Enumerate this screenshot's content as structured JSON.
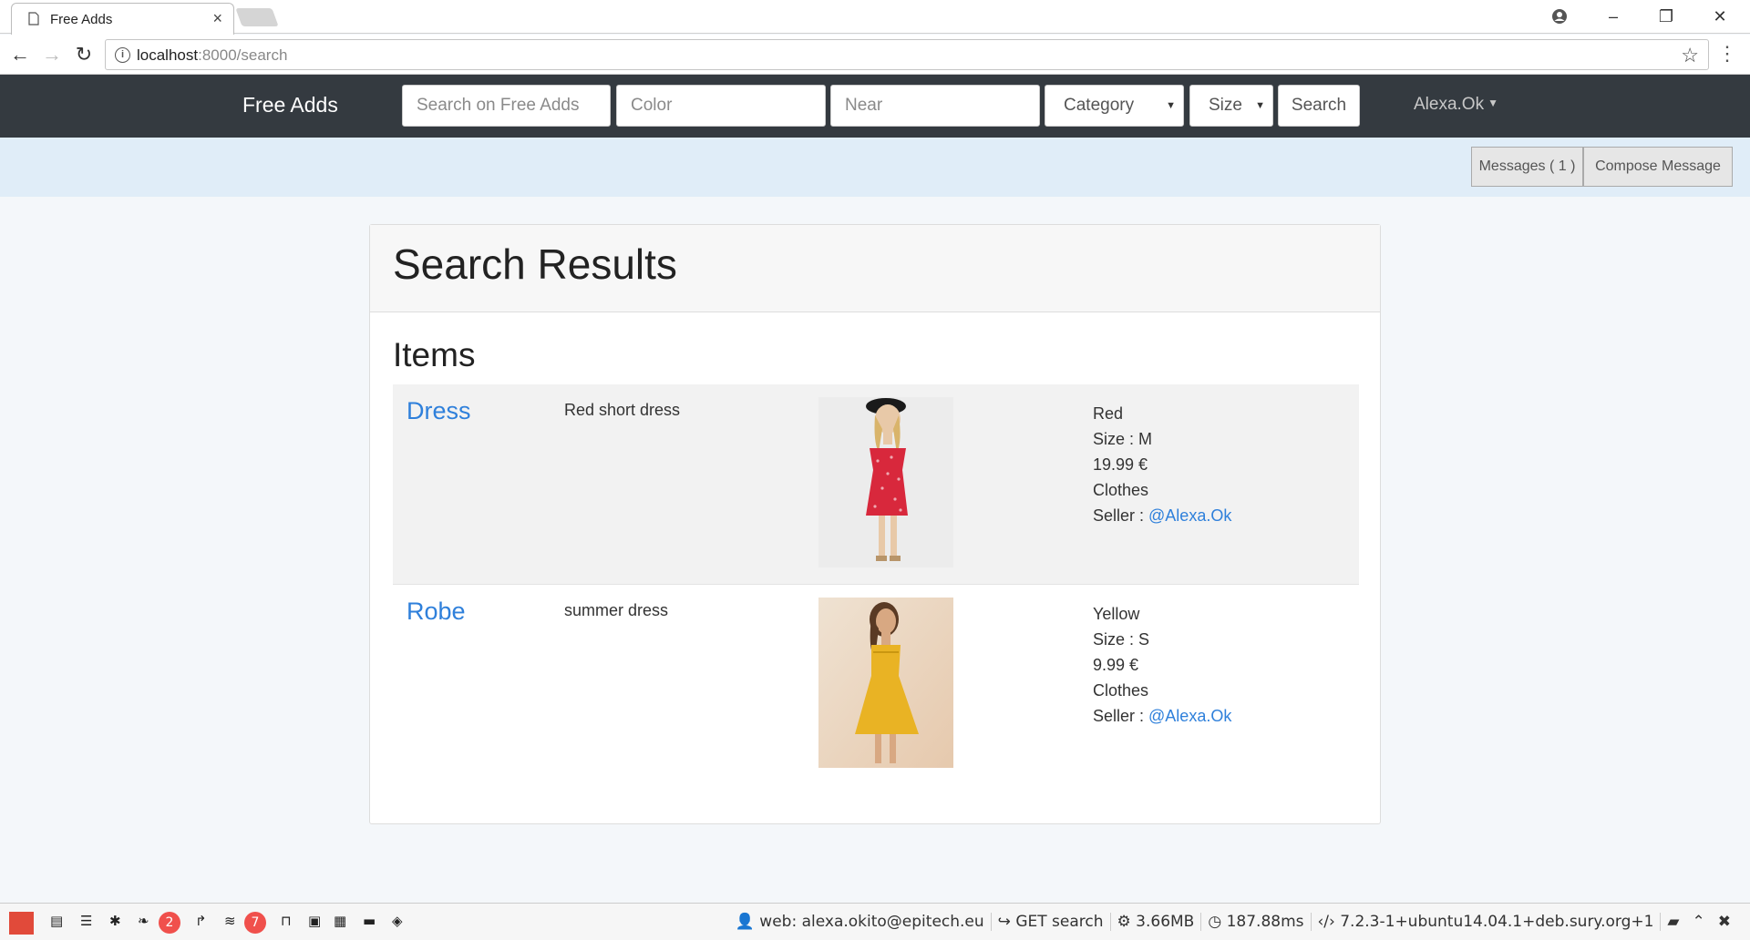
{
  "browser": {
    "tab_title": "Free Adds",
    "url_host": "localhost",
    "url_path": ":8000/search"
  },
  "navbar": {
    "brand": "Free Adds",
    "search_placeholder": "Search on Free Adds",
    "color_placeholder": "Color",
    "near_placeholder": "Near",
    "category_label": "Category",
    "size_label": "Size",
    "search_button": "Search",
    "user": "Alexa.Ok"
  },
  "subbar": {
    "messages_button": "Messages ( 1 )",
    "compose_button": "Compose Message"
  },
  "page": {
    "title": "Search Results",
    "items_heading": "Items"
  },
  "items": [
    {
      "name": "Dress",
      "description": "Red short dress",
      "color": "Red",
      "size": "Size : M",
      "price": "19.99 €",
      "category": "Clothes",
      "seller_label": "Seller : ",
      "seller": "@Alexa.Ok",
      "dress_color": "#d8283c"
    },
    {
      "name": "Robe",
      "description": "summer dress",
      "color": "Yellow",
      "size": "Size : S",
      "price": "9.99 €",
      "category": "Clothes",
      "seller_label": "Seller : ",
      "seller": "@Alexa.Ok",
      "dress_color": "#e9b324"
    }
  ],
  "debugbar": {
    "badge_logs": "2",
    "badge_queries": "7",
    "web_user": "web: alexa.okito@epitech.eu",
    "route": "GET search",
    "memory": "3.66MB",
    "time": "187.88ms",
    "php_version": "7.2.3-1+ubuntu14.04.1+deb.sury.org+1"
  }
}
